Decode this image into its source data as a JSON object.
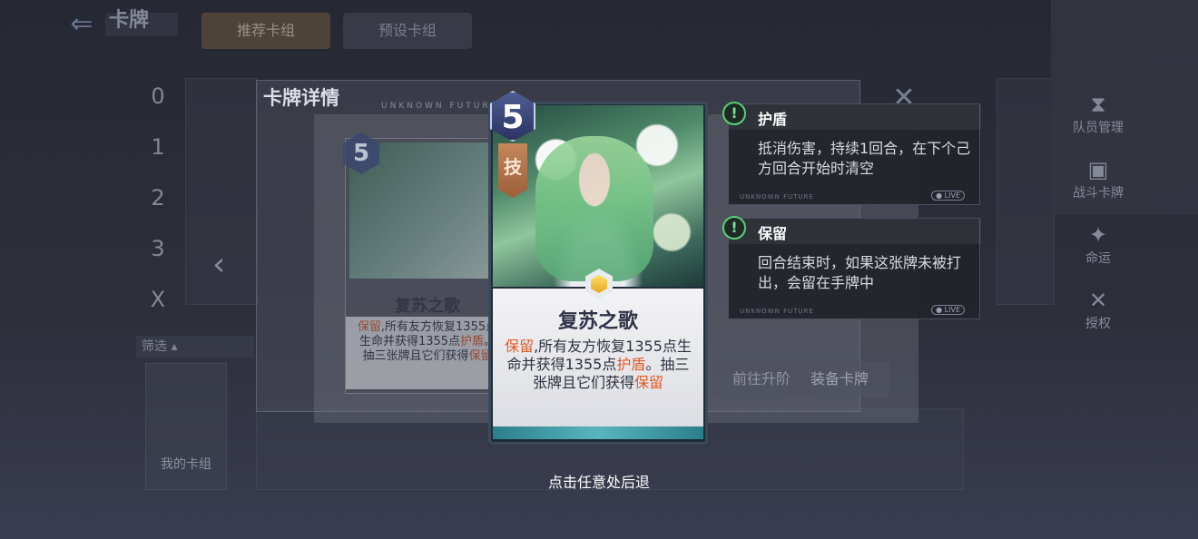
{
  "header": {
    "title": "卡牌",
    "back_icon": "arrow-left-icon",
    "tabs": [
      "推荐卡组",
      "预设卡组"
    ]
  },
  "deck_numbers": [
    "0",
    "1",
    "2",
    "3",
    "X"
  ],
  "side_nav": [
    {
      "label": "队员管理",
      "icon": "hourglass-icon"
    },
    {
      "label": "战斗卡牌",
      "icon": "cards-icon"
    },
    {
      "label": "命运",
      "icon": "star-icon"
    },
    {
      "label": "授权",
      "icon": "crossed-swords-icon"
    }
  ],
  "filter_label": "筛选",
  "my_cards_label": "我的卡组",
  "detail_panel": {
    "title": "卡牌详情",
    "subtitle": "UNKNOWN FUTURE",
    "buttons": [
      "前往升阶",
      "装备卡牌"
    ]
  },
  "card": {
    "cost": "5",
    "type": "技",
    "name": "复苏之歌",
    "desc_parts": [
      {
        "text": "保留",
        "highlight": true
      },
      {
        "text": ",所有友方恢复1355点生命并获得1355点",
        "highlight": false
      },
      {
        "text": "护盾",
        "highlight": true
      },
      {
        "text": "。抽三张牌且它们获得",
        "highlight": false
      },
      {
        "text": "保留",
        "highlight": true
      }
    ]
  },
  "tooltips": [
    {
      "title": "护盾",
      "body": "抵消伤害，持续1回合，在下个己方回合开始时清空",
      "footer": "UNKNOWN FUTURE",
      "badge": "● LIVE"
    },
    {
      "title": "保留",
      "body": "回合结束时，如果这张牌未被打出，会留在手牌中",
      "footer": "UNKNOWN FUTURE",
      "badge": "● LIVE"
    }
  ],
  "hint": "点击任意处后退",
  "colors": {
    "highlight": "#e15a26",
    "accent_green": "#57d178"
  }
}
